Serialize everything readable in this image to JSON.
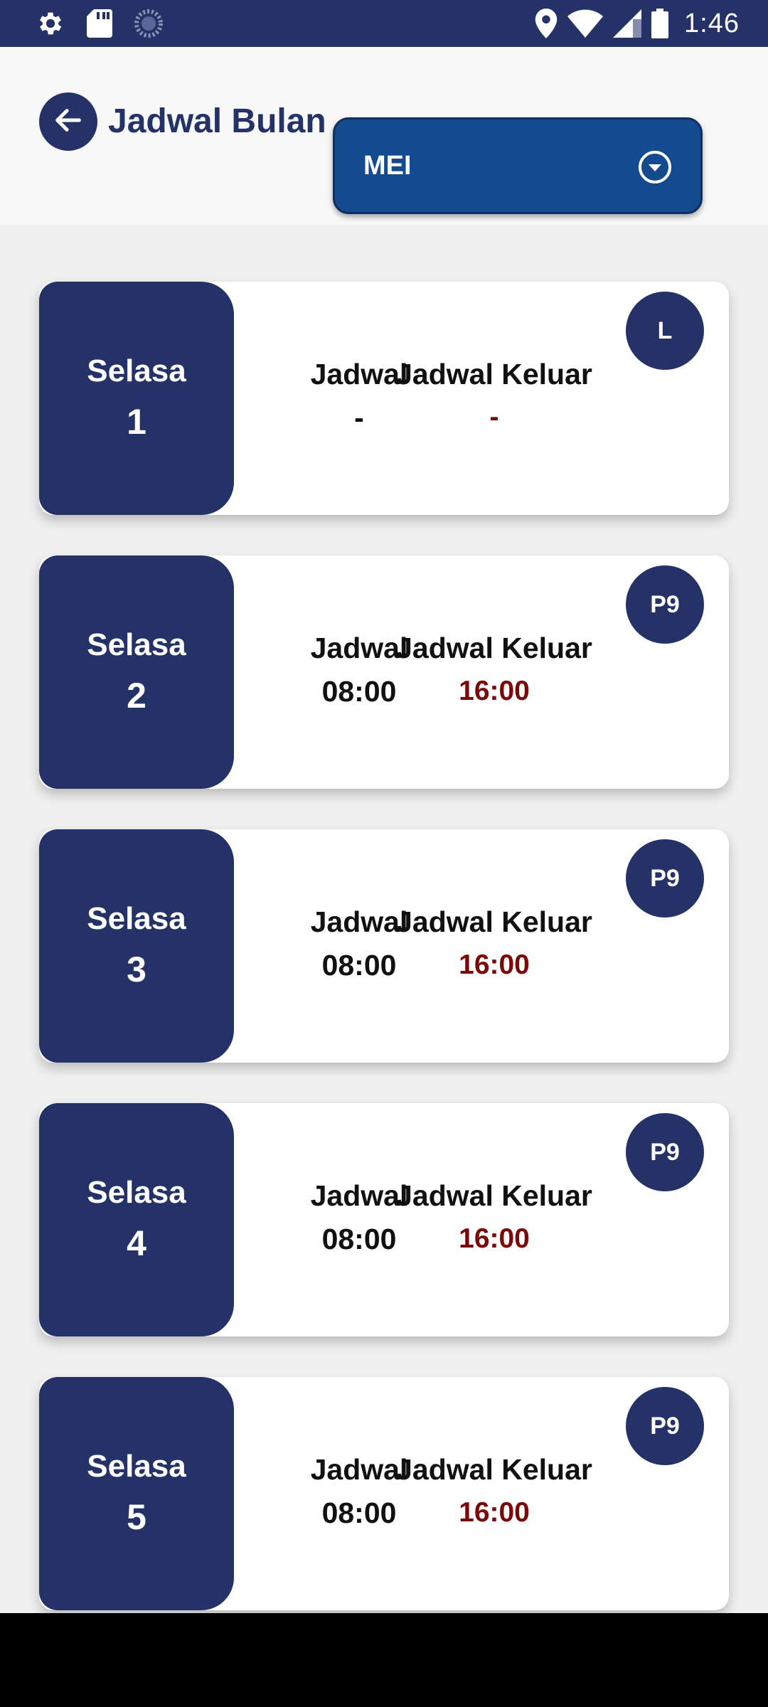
{
  "status_bar": {
    "time": "1:46",
    "left_icons": [
      "gear-icon",
      "sd-card-icon",
      "loading-icon"
    ],
    "right_icons": [
      "location-icon",
      "wifi-icon",
      "signal-icon",
      "battery-icon"
    ]
  },
  "header": {
    "title": "Jadwal Bulan",
    "month_select": {
      "value": "MEI"
    }
  },
  "labels": {
    "schedule_in": "Jadwal",
    "schedule_out": "Jadwal Keluar"
  },
  "schedule": [
    {
      "day": "Selasa",
      "date": "1",
      "in": "-",
      "out": "-",
      "code": "L"
    },
    {
      "day": "Selasa",
      "date": "2",
      "in": "08:00",
      "out": "16:00",
      "code": "P9"
    },
    {
      "day": "Selasa",
      "date": "3",
      "in": "08:00",
      "out": "16:00",
      "code": "P9"
    },
    {
      "day": "Selasa",
      "date": "4",
      "in": "08:00",
      "out": "16:00",
      "code": "P9"
    },
    {
      "day": "Selasa",
      "date": "5",
      "in": "08:00",
      "out": "16:00",
      "code": "P9"
    }
  ],
  "colors": {
    "primary": "#243267",
    "select_bg": "#134b8e",
    "out_time": "#7a0a0a"
  }
}
